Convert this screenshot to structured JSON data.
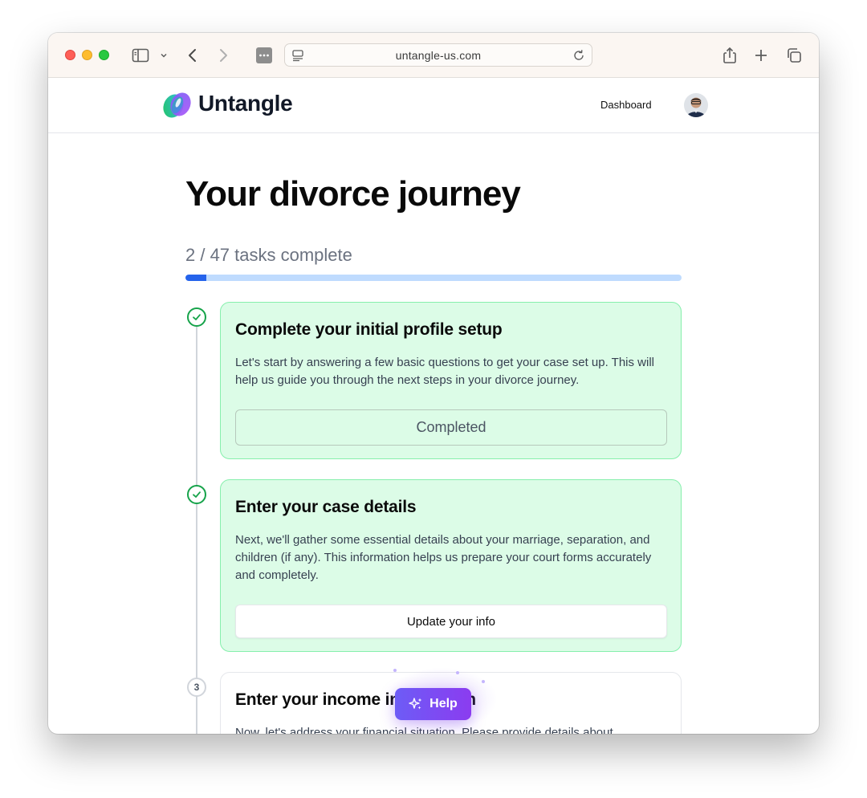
{
  "browser": {
    "url": "untangle-us.com"
  },
  "site": {
    "brand": "Untangle",
    "nav_dashboard": "Dashboard"
  },
  "page": {
    "title": "Your divorce journey",
    "progress_text": "2 / 47 tasks complete",
    "progress_completed": 2,
    "progress_total": 47
  },
  "steps": [
    {
      "status": "done",
      "title": "Complete your initial profile setup",
      "description": "Let's start by answering a few basic questions to get your case set up. This will help us guide you through the next steps in your divorce journey.",
      "button": "Completed"
    },
    {
      "status": "done",
      "title": "Enter your case details",
      "description": "Next, we'll gather some essential details about your marriage, separation, and children (if any). This information helps us prepare your court forms accurately and completely.",
      "button": "Update your info"
    },
    {
      "status": "pending",
      "number": "3",
      "title": "Enter your income information",
      "description": "Now, let's address your financial situation. Please provide details about"
    }
  ],
  "help": {
    "label": "Help"
  },
  "colors": {
    "accent_blue": "#2563eb",
    "done_green": "#16a34a",
    "card_done_bg": "#dcfce7",
    "help_purple": "#7c3aed"
  }
}
